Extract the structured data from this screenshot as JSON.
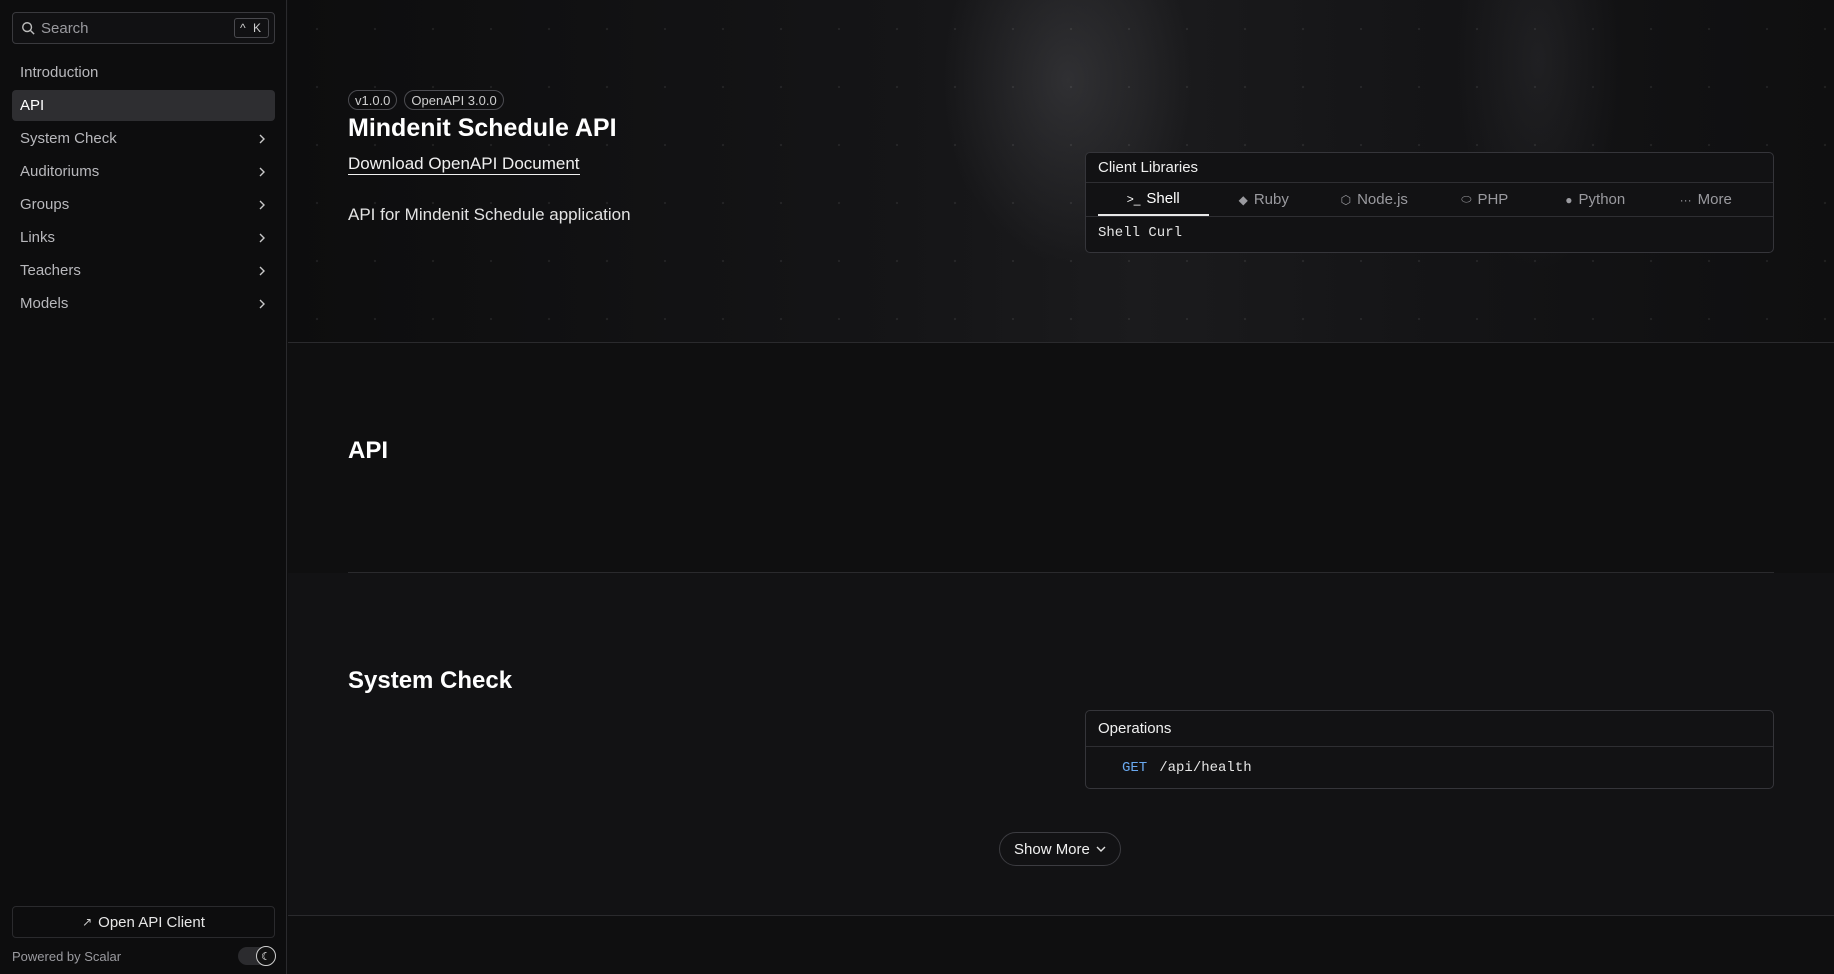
{
  "sidebar": {
    "search": {
      "label": "Search",
      "shortcut": "^ K"
    },
    "items": [
      {
        "label": "Introduction",
        "active": false,
        "expandable": false
      },
      {
        "label": "API",
        "active": true,
        "expandable": false
      },
      {
        "label": "System Check",
        "active": false,
        "expandable": true
      },
      {
        "label": "Auditoriums",
        "active": false,
        "expandable": true
      },
      {
        "label": "Groups",
        "active": false,
        "expandable": true
      },
      {
        "label": "Links",
        "active": false,
        "expandable": true
      },
      {
        "label": "Teachers",
        "active": false,
        "expandable": true
      },
      {
        "label": "Models",
        "active": false,
        "expandable": true
      }
    ],
    "open_client_label": "Open API Client",
    "powered_by": "Powered by Scalar"
  },
  "hero": {
    "version_badge": "v1.0.0",
    "openapi_badge": "OpenAPI 3.0.0",
    "title": "Mindenit Schedule API",
    "download_label": "Download OpenAPI Document",
    "description": "API for Mindenit Schedule application"
  },
  "client_libraries": {
    "heading": "Client Libraries",
    "tabs": [
      {
        "label": "Shell",
        "icon": "terminal-icon",
        "active": true
      },
      {
        "label": "Ruby",
        "icon": "ruby-icon",
        "active": false
      },
      {
        "label": "Node.js",
        "icon": "nodejs-icon",
        "active": false
      },
      {
        "label": "PHP",
        "icon": "php-icon",
        "active": false
      },
      {
        "label": "Python",
        "icon": "python-icon",
        "active": false
      },
      {
        "label": "More",
        "icon": "more-icon",
        "active": false
      }
    ],
    "selected_client": "Shell Curl"
  },
  "api_section": {
    "heading": "API"
  },
  "system_check": {
    "heading": "System Check",
    "operations_heading": "Operations",
    "operations": [
      {
        "method": "GET",
        "path": "/api/health"
      }
    ],
    "show_more_label": "Show More"
  },
  "colors": {
    "get_method": "#6aa9f0",
    "background": "#0f0f10"
  }
}
